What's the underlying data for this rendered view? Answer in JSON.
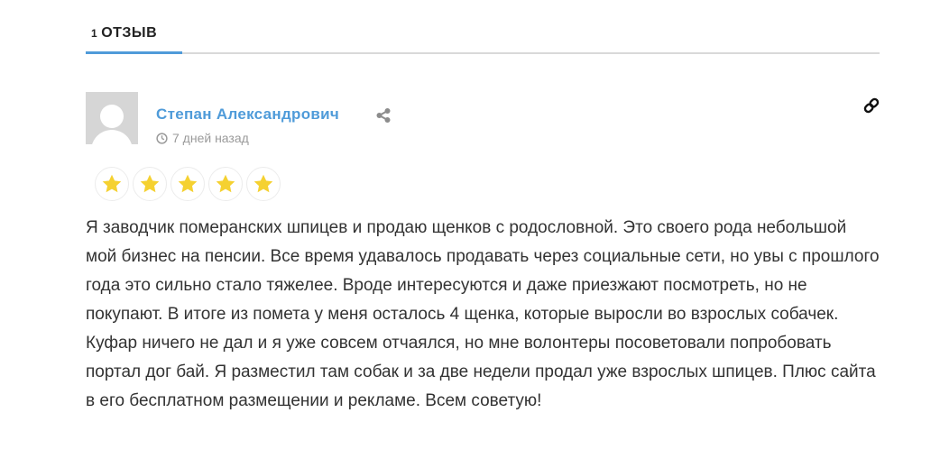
{
  "tabs": [
    {
      "count": "1",
      "label": "ОТЗЫВ"
    }
  ],
  "review": {
    "author": "Степан Александрович",
    "time": "7 дней назад",
    "rating": 5,
    "rating_max": 5,
    "star_color": "#f5d131",
    "text": "Я заводчик померанских шпицев и продаю щенков с родословной. Это своего рода небольшой мой бизнес на пенсии. Все время удавалось продавать через социальные сети, но увы с прошлого года это сильно стало тяжелее. Вроде интересуются и даже приезжают посмотреть, но не покупают. В итоге из помета у меня осталось 4 щенка, которые выросли во взрослых собачек. Куфар ничего не дал и я уже совсем отчаялся, но мне волонтеры посоветовали попробовать портал дог бай. Я разместил там собак и за две недели продал уже взрослых шпицев. Плюс сайта в его бесплатном размещении и рекламе. Всем советую!"
  },
  "icons": {
    "share": "share-icon",
    "clock": "clock-icon",
    "link": "link-icon",
    "avatar": "avatar-placeholder"
  },
  "colors": {
    "accent": "#4f9bd9",
    "muted": "#9a9a9a"
  }
}
